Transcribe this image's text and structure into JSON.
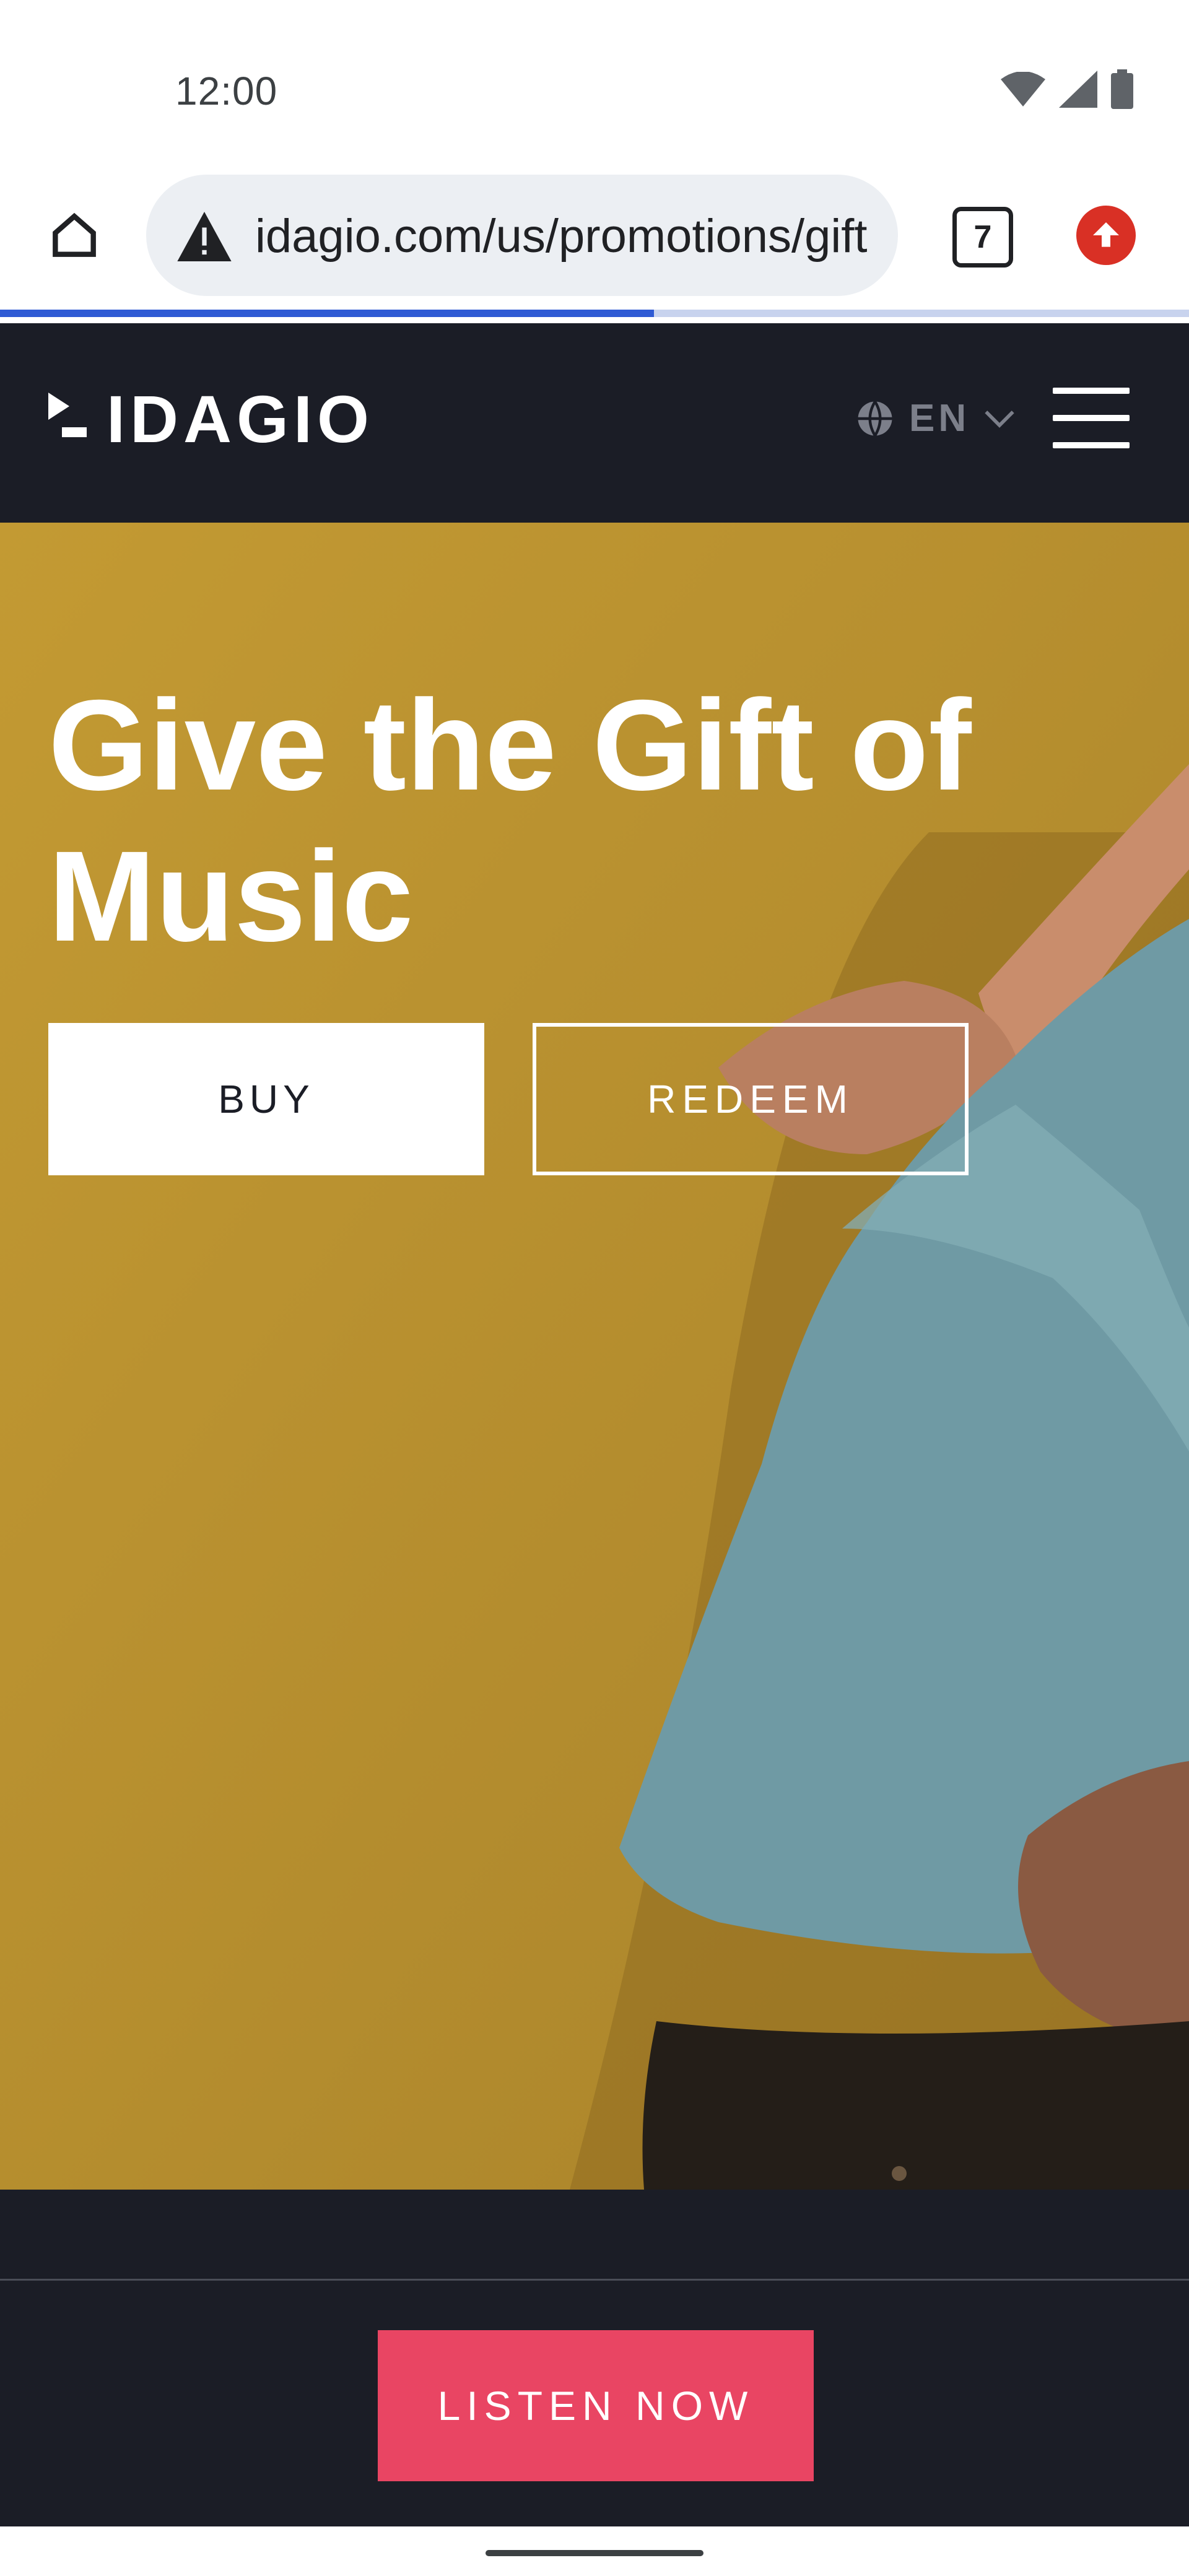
{
  "status_bar": {
    "time": "12:00",
    "icons": [
      "wifi-icon",
      "signal-icon",
      "battery-icon"
    ]
  },
  "browser": {
    "url": "idagio.com/us/promotions/gift",
    "tab_count": "7",
    "security_icon": "warning-icon",
    "home_icon": "home-icon",
    "update_icon": "update-arrow-icon",
    "load_progress": 0.55
  },
  "site": {
    "logo": "IDAGIO",
    "language": "EN",
    "menu_icon": "hamburger-menu-icon",
    "globe_icon": "globe-icon"
  },
  "hero": {
    "title": "Give the Gift of Music",
    "buy_label": "BUY",
    "redeem_label": "REDEEM"
  },
  "cta": {
    "listen_label": "LISTEN NOW"
  },
  "colors": {
    "hero_background": "#b9922e",
    "header_background": "#1b1d26",
    "cta_pink": "#e94563",
    "progress_blue": "#2f5bd4"
  }
}
